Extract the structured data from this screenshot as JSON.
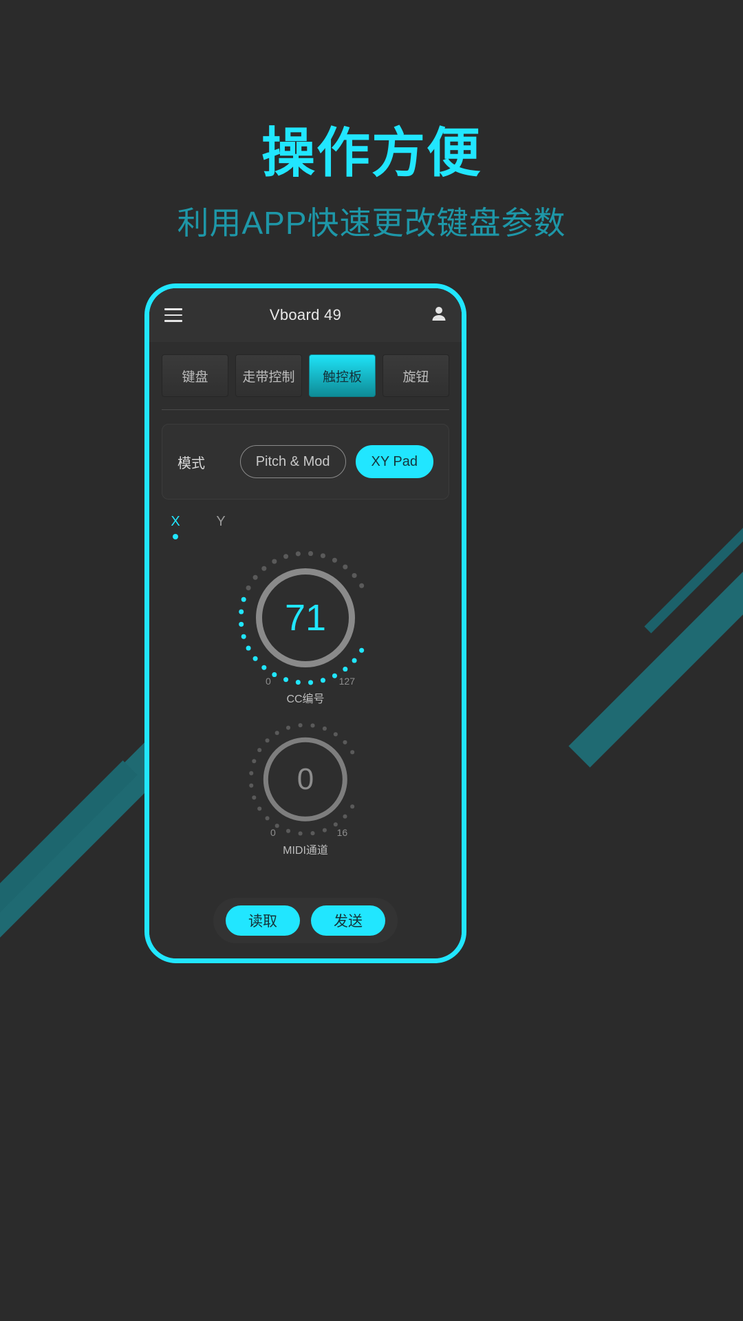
{
  "promo": {
    "title": "操作方便",
    "subtitle": "利用APP快速更改键盘参数",
    "accent": "#21e6ff",
    "subtitle_color": "#1e97a8",
    "background": "#2b2b2b",
    "stripe_color": "#1f6a72"
  },
  "app": {
    "appbar": {
      "menu_icon": "hamburger-icon",
      "title": "Vboard 49",
      "account_icon": "person-icon"
    },
    "tabs": [
      {
        "label": "键盘",
        "active": false
      },
      {
        "label": "走带控制",
        "active": false
      },
      {
        "label": "触控板",
        "active": true
      },
      {
        "label": "旋钮",
        "active": false
      }
    ],
    "mode_row": {
      "label": "模式",
      "options": [
        {
          "label": "Pitch & Mod",
          "selected": false
        },
        {
          "label": "XY Pad",
          "selected": true
        }
      ]
    },
    "axis_tabs": [
      {
        "label": "X",
        "active": true
      },
      {
        "label": "Y",
        "active": false
      }
    ],
    "knobs": [
      {
        "value": "71",
        "min": "0",
        "max": "127",
        "caption": "CC编号",
        "value_color": "#21e6ff",
        "dot_count": 28,
        "dots_on": 16
      },
      {
        "value": "0",
        "min": "0",
        "max": "16",
        "caption": "MIDI通道",
        "value_color": "#8d8d8d",
        "dot_count": 24,
        "dots_on": 0
      }
    ],
    "footer": {
      "buttons": [
        {
          "label": "读取"
        },
        {
          "label": "发送"
        }
      ]
    }
  }
}
